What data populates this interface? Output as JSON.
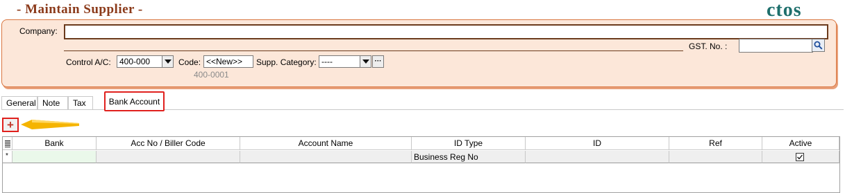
{
  "window": {
    "title": "- Maintain Supplier -",
    "logo_text": "ctos"
  },
  "form": {
    "company_label": "Company:",
    "company_value": "",
    "gst_label": "GST. No. :",
    "gst_value": "",
    "control_ac_label": "Control A/C:",
    "control_ac_value": "400-000",
    "code_label": "Code:",
    "code_value": "<<New>>",
    "code_hint": "400-0001",
    "supp_category_label": "Supp. Category:",
    "supp_category_value": "----",
    "ellipsis_label": "···"
  },
  "tabs": [
    {
      "label": "General"
    },
    {
      "label": "Note"
    },
    {
      "label": "Tax"
    },
    {
      "label": "Bank Account",
      "active": true
    }
  ],
  "toolbar": {
    "add_label": "+"
  },
  "grid": {
    "columns": [
      "Bank",
      "Acc No / Biller Code",
      "Account Name",
      "ID Type",
      "ID",
      "Ref",
      "Active"
    ],
    "new_row": {
      "bank": "",
      "acc_no": "",
      "account_name": "",
      "id_type": "Business Reg No",
      "id": "",
      "ref": "",
      "active": true
    }
  },
  "colors": {
    "title": "#8B3A1A",
    "logo": "#1E6F6C",
    "panel_bg": "#FCE7D9",
    "panel_border": "#D9753F",
    "highlight": "#E0201D",
    "arrow": "#F5B400"
  }
}
